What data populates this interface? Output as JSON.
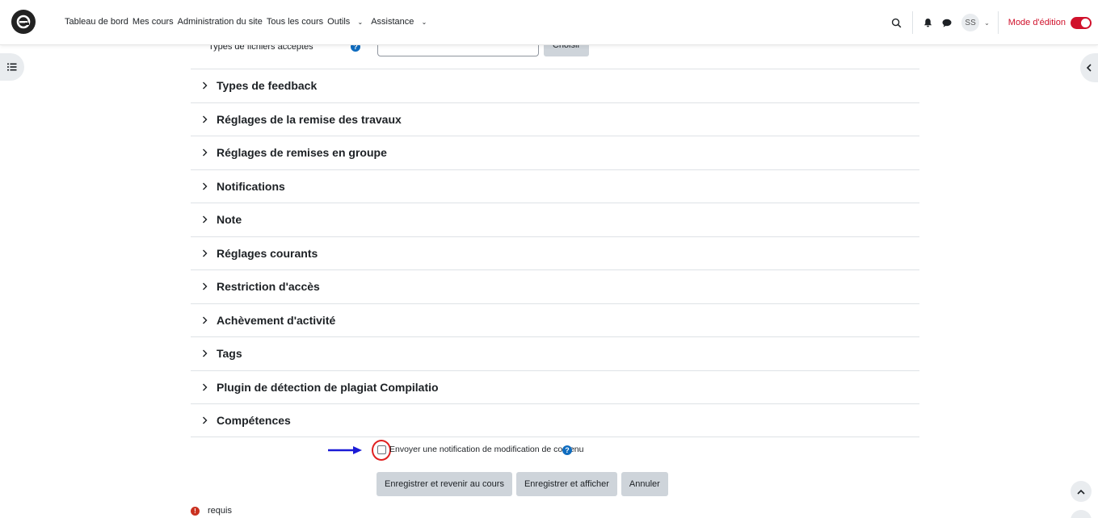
{
  "nav": {
    "links": [
      {
        "label": "Tableau de bord"
      },
      {
        "label": "Mes cours"
      },
      {
        "label": "Administration du site"
      },
      {
        "label": "Tous les cours"
      },
      {
        "label": "Outils",
        "dropdown": true
      },
      {
        "label": "Assistance",
        "dropdown": true
      }
    ],
    "user_initials": "SS",
    "edit_mode_label": "Mode d'édition",
    "edit_mode_on": true
  },
  "file_types": {
    "label": "Types de fichiers acceptés",
    "input_value": "",
    "choose_label": "Choisir"
  },
  "sections": [
    {
      "title": "Types de feedback"
    },
    {
      "title": "Réglages de la remise des travaux"
    },
    {
      "title": "Réglages de remises en groupe"
    },
    {
      "title": "Notifications"
    },
    {
      "title": "Note"
    },
    {
      "title": "Réglages courants"
    },
    {
      "title": "Restriction d'accès"
    },
    {
      "title": "Achèvement d'activité"
    },
    {
      "title": "Tags"
    },
    {
      "title": "Plugin de détection de plagiat Compilatio"
    },
    {
      "title": "Compétences"
    }
  ],
  "notify": {
    "label": "Envoyer une notification de modification de contenu",
    "checked": false
  },
  "buttons": {
    "save_return": "Enregistrer et revenir au cours",
    "save_display": "Enregistrer et afficher",
    "cancel": "Annuler"
  },
  "required_label": "requis",
  "colors": {
    "accent_red": "#d0112b",
    "help_blue": "#0f6cbf",
    "annotation_arrow": "#1a1ad6",
    "annotation_circle": "#e02020"
  }
}
